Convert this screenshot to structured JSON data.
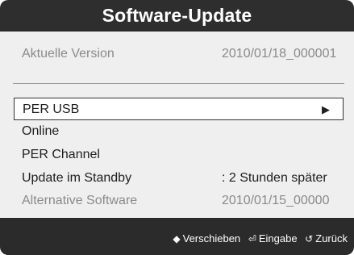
{
  "dialog": {
    "title": "Software-Update"
  },
  "version": {
    "label": "Aktuelle Version",
    "value": "2010/01/18_000001"
  },
  "menu": {
    "items": [
      {
        "label": "PER USB",
        "value": "",
        "selected": true,
        "arrow_icon": "play-right-icon",
        "arrow_glyph": "▶"
      },
      {
        "label": "Online",
        "value": ""
      },
      {
        "label": "PER Channel",
        "value": ""
      },
      {
        "label": "Update im Standby",
        "value": ": 2 Stunden später"
      },
      {
        "label": "Alternative Software",
        "value": "2010/01/15_00000",
        "disabled": true
      }
    ]
  },
  "footer": {
    "hints": [
      {
        "icon": "up-down-arrow-icon",
        "glyph": "◆",
        "label": "Verschieben"
      },
      {
        "icon": "enter-icon",
        "glyph": "⏎",
        "label": "Eingabe"
      },
      {
        "icon": "return-icon",
        "glyph": "↺",
        "label": "Zurück"
      }
    ]
  },
  "colors": {
    "title_bar": "#2e2e2e",
    "content_bg": "#efefef",
    "footer_bg": "#2b2b2b",
    "muted_text": "#8a8a8a"
  }
}
